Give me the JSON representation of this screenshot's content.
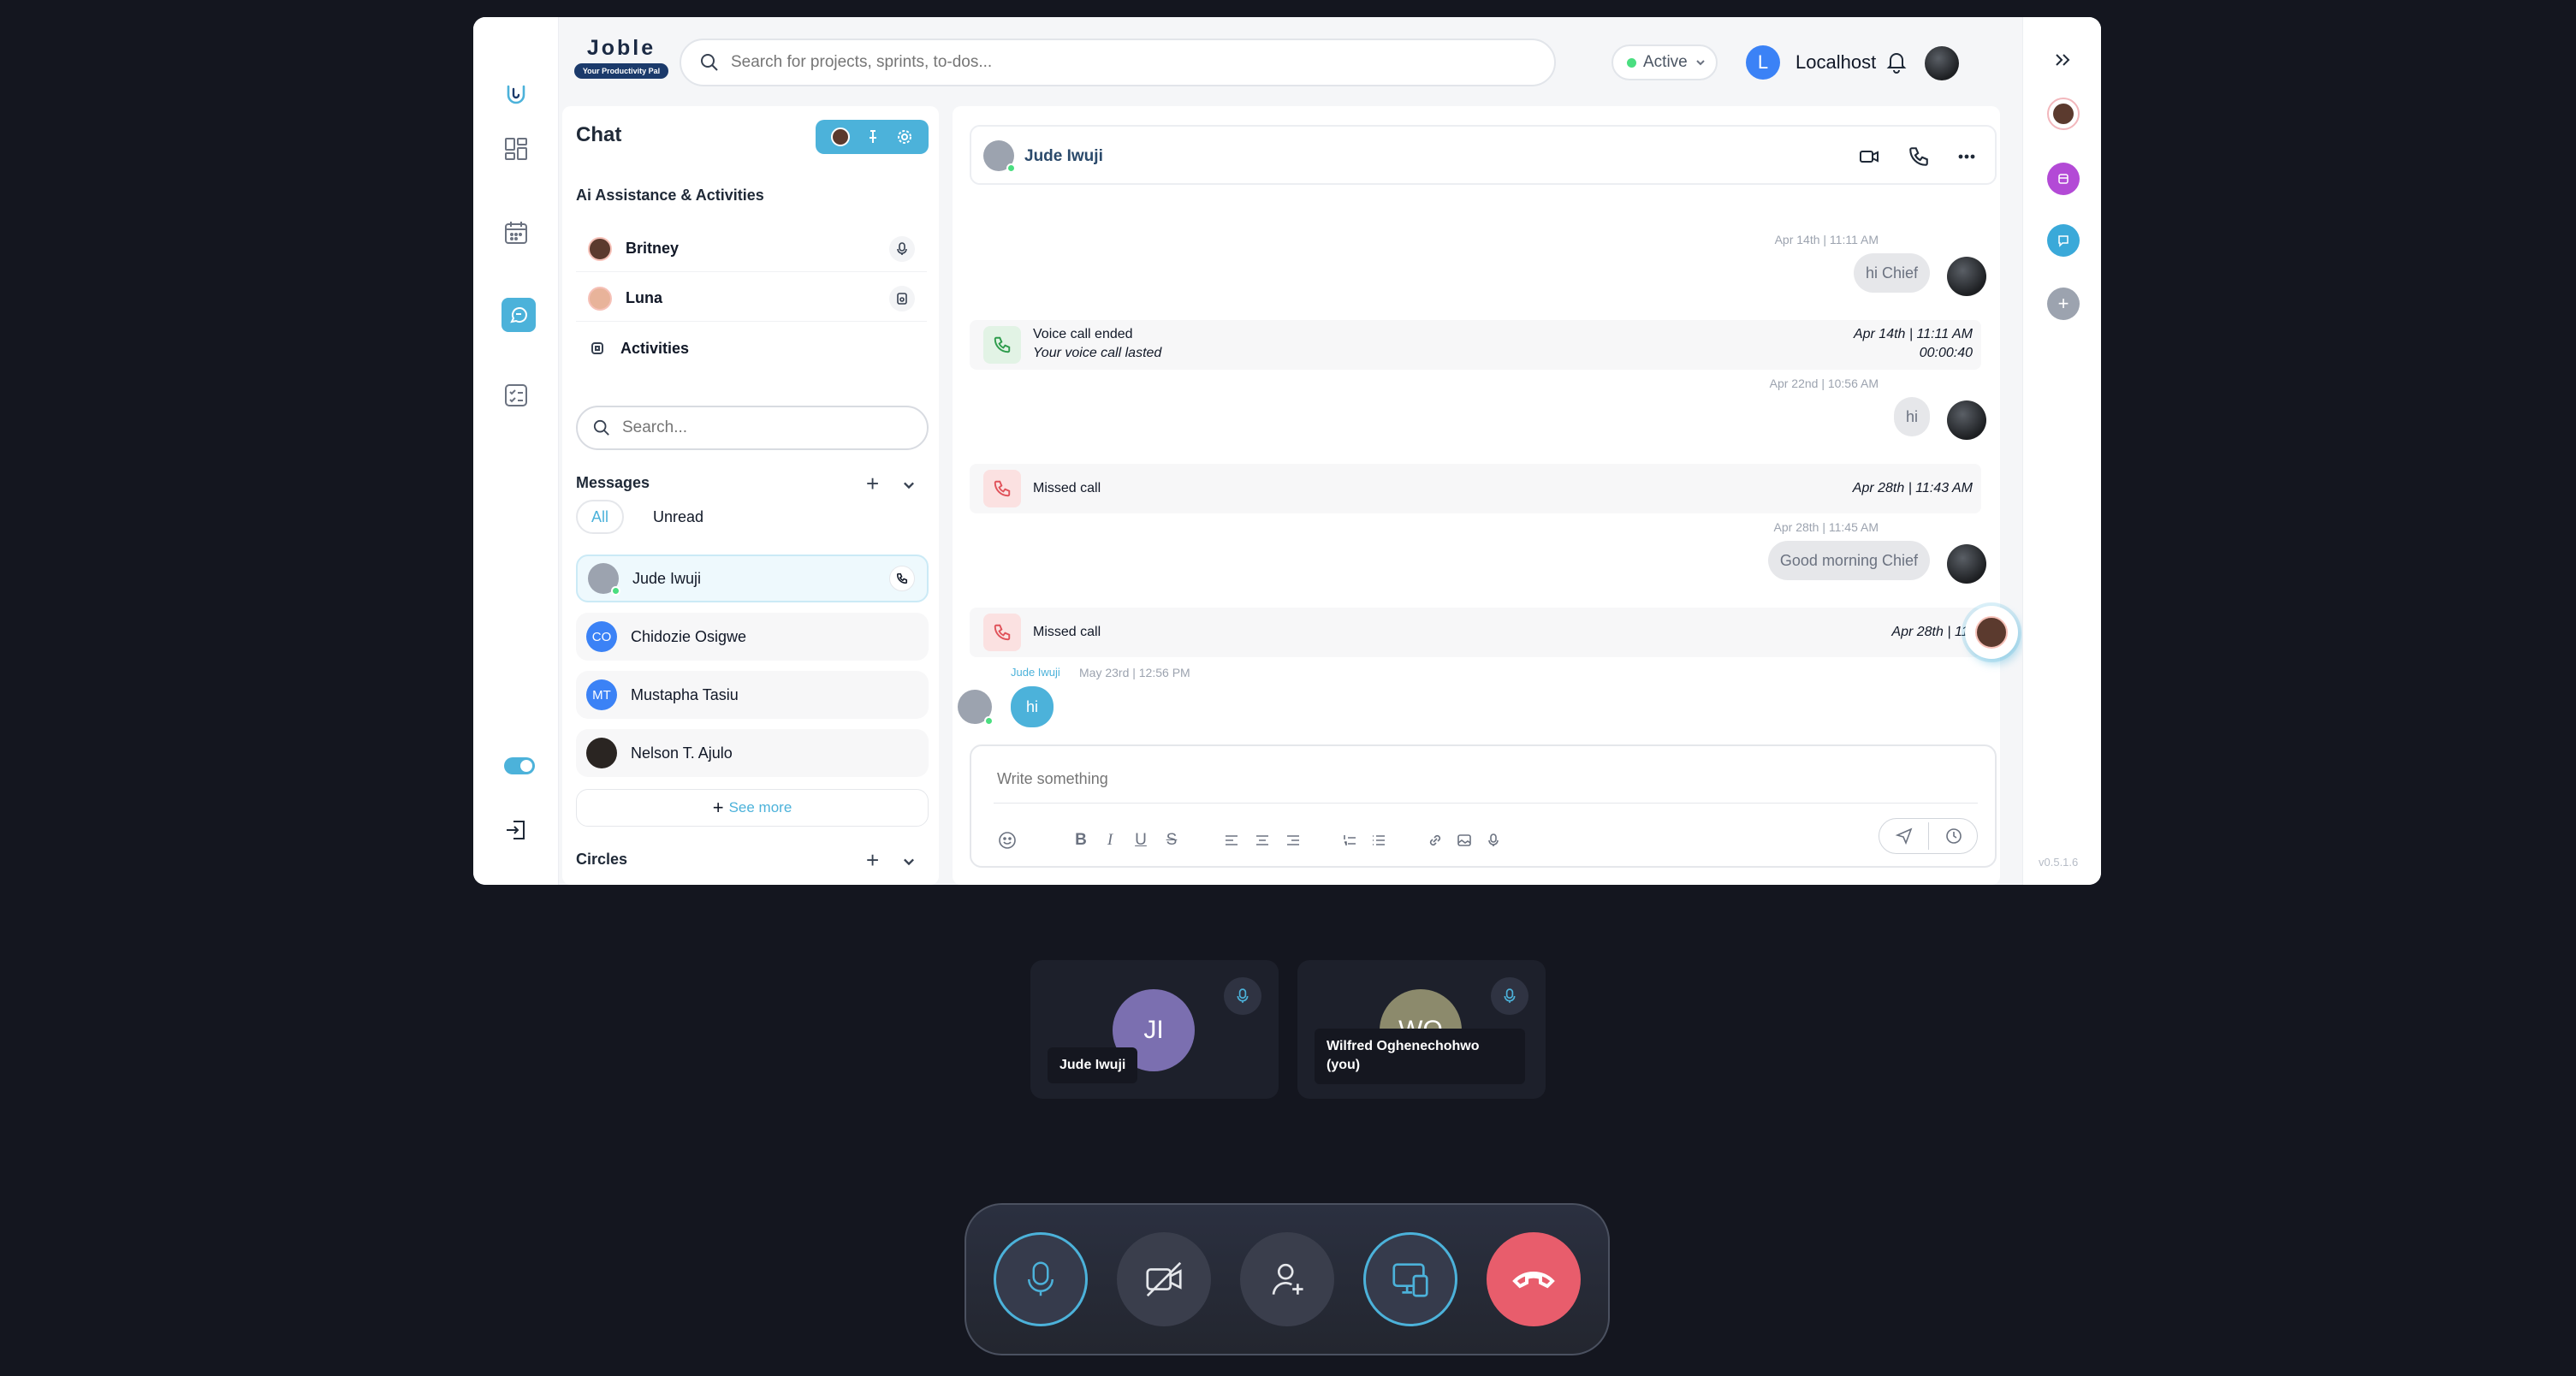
{
  "app": {
    "brand_name": "Joble",
    "brand_tagline": "Your Productivity Pal",
    "search_placeholder": "Search for projects, sprints, to-dos...",
    "status": "Active",
    "user_initial": "L",
    "user_name": "Localhost",
    "version": "v0.5.1.6"
  },
  "rail": {
    "icons": [
      "logo-icon",
      "dashboard-icon",
      "calendar-icon",
      "chat-icon",
      "tasks-icon"
    ],
    "active": "chat-icon"
  },
  "panel": {
    "title": "Chat",
    "ai_heading": "Ai Assistance & Activities",
    "ai_items": [
      {
        "label": "Britney"
      },
      {
        "label": "Luna"
      },
      {
        "label": "Activities"
      }
    ],
    "search_placeholder": "Search...",
    "messages_heading": "Messages",
    "tabs": [
      {
        "label": "All"
      },
      {
        "label": "Unread"
      }
    ],
    "contacts": [
      {
        "name": "Jude Iwuji",
        "initials": ""
      },
      {
        "name": "Chidozie Osigwe",
        "initials": "CO"
      },
      {
        "name": "Mustapha Tasiu",
        "initials": "MT"
      },
      {
        "name": "Nelson T. Ajulo",
        "initials": ""
      }
    ],
    "see_more": "See more",
    "circles_heading": "Circles"
  },
  "conversation": {
    "contact_name": "Jude Iwuji",
    "messages": [
      {
        "time": "Apr 14th | 11:11 AM",
        "text": "hi Chief"
      },
      {
        "call_title": "Voice call ended",
        "call_sub": "Your voice call lasted",
        "call_time": "Apr 14th | 11:11 AM",
        "call_duration": "00:00:40"
      },
      {
        "time": "Apr 22nd | 10:56 AM",
        "text": "hi"
      },
      {
        "call_title": "Missed call",
        "call_time": "Apr 28th | 11:43 AM"
      },
      {
        "time": "Apr 28th | 11:45 AM",
        "text": "Good morning Chief"
      },
      {
        "call_title": "Missed call",
        "call_time": "Apr 28th | 11:"
      },
      {
        "sender": "Jude Iwuji",
        "time": "May 23rd | 12:56 PM",
        "text": "hi"
      }
    ],
    "composer_placeholder": "Write something"
  },
  "call": {
    "participants": [
      {
        "initials": "JI",
        "name": "Jude Iwuji",
        "color": "#7b6fb0"
      },
      {
        "initials": "WO",
        "name": "Wilfred Oghenechohwo (you)",
        "color": "#8c8a6c"
      }
    ],
    "controls": [
      "microphone-icon",
      "camera-off-icon",
      "add-person-icon",
      "screen-share-icon",
      "hang-up-icon"
    ],
    "colors": {
      "accent": "#4cb2da",
      "hangup": "#e85d6c",
      "online": "#4ade80"
    }
  }
}
